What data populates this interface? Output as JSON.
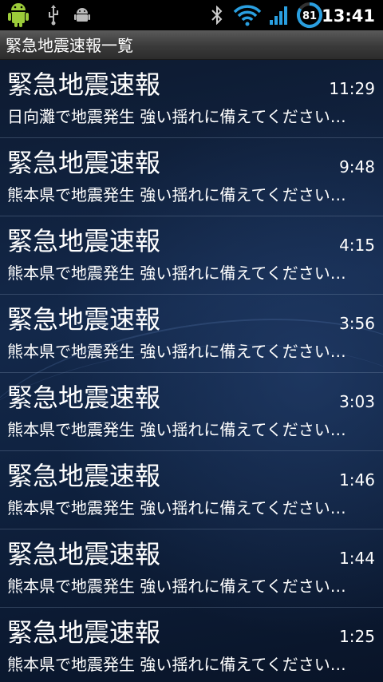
{
  "status_bar": {
    "time": "13:41",
    "battery_level": "81",
    "icons": [
      "android-robot-icon",
      "usb-icon",
      "android-debug-icon",
      "bluetooth-icon",
      "wifi-icon",
      "signal-icon",
      "battery-icon"
    ]
  },
  "header": {
    "title": "緊急地震速報一覧"
  },
  "list": {
    "items": [
      {
        "title": "緊急地震速報",
        "time": "11:29",
        "body": "日向灘で地震発生 強い揺れに備えてください…"
      },
      {
        "title": "緊急地震速報",
        "time": "9:48",
        "body": "熊本県で地震発生 強い揺れに備えてください…"
      },
      {
        "title": "緊急地震速報",
        "time": "4:15",
        "body": "熊本県で地震発生 強い揺れに備えてください…"
      },
      {
        "title": "緊急地震速報",
        "time": "3:56",
        "body": "熊本県で地震発生 強い揺れに備えてください…"
      },
      {
        "title": "緊急地震速報",
        "time": "3:03",
        "body": "熊本県で地震発生 強い揺れに備えてください…"
      },
      {
        "title": "緊急地震速報",
        "time": "1:46",
        "body": "熊本県で地震発生 強い揺れに備えてください…"
      },
      {
        "title": "緊急地震速報",
        "time": "1:44",
        "body": "熊本県で地震発生 強い揺れに備えてください…"
      },
      {
        "title": "緊急地震速報",
        "time": "1:25",
        "body": "熊本県で地震発生 強い揺れに備えてください…"
      }
    ]
  }
}
